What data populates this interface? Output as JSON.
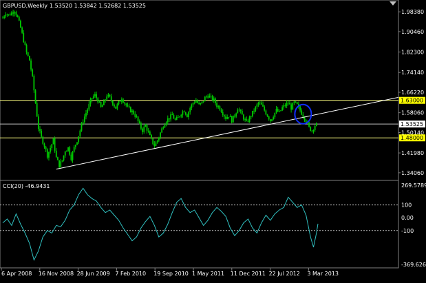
{
  "main_chart": {
    "title": "GBPUSD,Weekly",
    "ohlc": "1.53520 1.53842 1.52682 1.53525",
    "price_ticks": [
      "1.98380",
      "1.90460",
      "1.82300",
      "1.74140",
      "1.66220",
      "1.58060",
      "1.50140",
      "1.41980",
      "1.34060"
    ],
    "current_price": "1.53525",
    "levels": [
      {
        "label": "1.63000",
        "value": 1.63
      },
      {
        "label": "1.48000",
        "value": 1.48
      }
    ],
    "support_level": 1.53525,
    "trendline": {
      "start": {
        "date": "Oct 2008",
        "price": 1.355
      },
      "end": {
        "date": "Mar 2013+",
        "price": 1.64
      }
    },
    "highlight_circle": {
      "date": "Jan 2013",
      "price": 1.575
    }
  },
  "cci_panel": {
    "title": "CCI(20) -46.9431",
    "ticks": [
      "269.5789",
      "100",
      "0.00",
      "-100",
      "-369.6264"
    ],
    "levels": [
      100,
      -100
    ]
  },
  "date_ticks": [
    "6 Apr 2008",
    "16 Nov 2008",
    "28 Jun 2009",
    "7 Feb 2010",
    "19 Sep 2010",
    "1 May 2011",
    "11 Dec 2011",
    "22 Jul 2012",
    "3 Mar 2013"
  ],
  "colors": {
    "background": "#000000",
    "candle": "#00c800",
    "grid_level": "#ffff80",
    "price_line": "#c0c0c0",
    "trendline": "#ffffff",
    "cci_line": "#30c0c0",
    "circle": "#1030ff",
    "price_tag": "#ffffff",
    "level_tag": "#ffff00"
  },
  "chart_data": [
    {
      "type": "candlestick",
      "title": "GBPUSD,Weekly",
      "ylim": [
        1.31,
        2.02
      ],
      "x": [
        "6 Apr 2008",
        "16 Nov 2008",
        "28 Jun 2009",
        "7 Feb 2010",
        "19 Sep 2010",
        "1 May 2011",
        "11 Dec 2011",
        "22 Jul 2012",
        "3 Mar 2013"
      ],
      "close_path": [
        [
          0,
          1.96
        ],
        [
          2,
          1.98
        ],
        [
          4,
          1.97
        ],
        [
          6,
          1.98
        ],
        [
          8,
          1.99
        ],
        [
          10,
          1.96
        ],
        [
          12,
          1.92
        ],
        [
          14,
          1.87
        ],
        [
          16,
          1.82
        ],
        [
          18,
          1.79
        ],
        [
          20,
          1.72
        ],
        [
          22,
          1.62
        ],
        [
          24,
          1.52
        ],
        [
          26,
          1.48
        ],
        [
          28,
          1.45
        ],
        [
          30,
          1.41
        ],
        [
          32,
          1.44
        ],
        [
          34,
          1.47
        ],
        [
          36,
          1.4
        ],
        [
          38,
          1.37
        ],
        [
          40,
          1.39
        ],
        [
          42,
          1.43
        ],
        [
          44,
          1.44
        ],
        [
          46,
          1.4
        ],
        [
          48,
          1.44
        ],
        [
          50,
          1.47
        ],
        [
          52,
          1.51
        ],
        [
          54,
          1.55
        ],
        [
          56,
          1.58
        ],
        [
          58,
          1.61
        ],
        [
          60,
          1.64
        ],
        [
          62,
          1.65
        ],
        [
          64,
          1.63
        ],
        [
          66,
          1.6
        ],
        [
          68,
          1.62
        ],
        [
          70,
          1.65
        ],
        [
          72,
          1.64
        ],
        [
          74,
          1.62
        ],
        [
          76,
          1.6
        ],
        [
          78,
          1.62
        ],
        [
          80,
          1.64
        ],
        [
          82,
          1.62
        ],
        [
          84,
          1.6
        ],
        [
          86,
          1.59
        ],
        [
          88,
          1.58
        ],
        [
          90,
          1.56
        ],
        [
          92,
          1.53
        ],
        [
          94,
          1.51
        ],
        [
          96,
          1.53
        ],
        [
          98,
          1.5
        ],
        [
          100,
          1.47
        ],
        [
          102,
          1.45
        ],
        [
          104,
          1.47
        ],
        [
          106,
          1.5
        ],
        [
          108,
          1.53
        ],
        [
          110,
          1.55
        ],
        [
          112,
          1.56
        ],
        [
          114,
          1.57
        ],
        [
          116,
          1.55
        ],
        [
          118,
          1.56
        ],
        [
          120,
          1.58
        ],
        [
          122,
          1.59
        ],
        [
          124,
          1.57
        ],
        [
          126,
          1.6
        ],
        [
          128,
          1.62
        ],
        [
          130,
          1.63
        ],
        [
          132,
          1.61
        ],
        [
          134,
          1.62
        ],
        [
          136,
          1.64
        ],
        [
          138,
          1.65
        ],
        [
          140,
          1.64
        ],
        [
          142,
          1.63
        ],
        [
          144,
          1.61
        ],
        [
          146,
          1.6
        ],
        [
          148,
          1.58
        ],
        [
          150,
          1.56
        ],
        [
          152,
          1.57
        ],
        [
          154,
          1.55
        ],
        [
          156,
          1.57
        ],
        [
          158,
          1.6
        ],
        [
          160,
          1.58
        ],
        [
          162,
          1.56
        ],
        [
          164,
          1.54
        ],
        [
          166,
          1.56
        ],
        [
          168,
          1.58
        ],
        [
          170,
          1.6
        ],
        [
          172,
          1.62
        ],
        [
          174,
          1.61
        ],
        [
          176,
          1.59
        ],
        [
          178,
          1.57
        ],
        [
          180,
          1.55
        ],
        [
          182,
          1.57
        ],
        [
          184,
          1.59
        ],
        [
          186,
          1.58
        ],
        [
          188,
          1.6
        ],
        [
          190,
          1.61
        ],
        [
          192,
          1.62
        ],
        [
          194,
          1.6
        ],
        [
          196,
          1.62
        ],
        [
          198,
          1.61
        ],
        [
          200,
          1.59
        ],
        [
          202,
          1.57
        ],
        [
          204,
          1.55
        ],
        [
          206,
          1.52
        ],
        [
          208,
          1.51
        ],
        [
          210,
          1.53
        ],
        [
          212,
          1.53525
        ]
      ]
    },
    {
      "type": "line",
      "title": "CCI(20) -46.9431",
      "ylim": [
        -369.6264,
        269.5789
      ],
      "points": [
        [
          0,
          -40
        ],
        [
          3,
          -10
        ],
        [
          6,
          -60
        ],
        [
          9,
          30
        ],
        [
          12,
          -50
        ],
        [
          15,
          -120
        ],
        [
          18,
          -200
        ],
        [
          21,
          -330
        ],
        [
          24,
          -260
        ],
        [
          27,
          -150
        ],
        [
          30,
          -100
        ],
        [
          33,
          -120
        ],
        [
          36,
          -60
        ],
        [
          39,
          -70
        ],
        [
          42,
          -20
        ],
        [
          45,
          60
        ],
        [
          48,
          100
        ],
        [
          51,
          180
        ],
        [
          54,
          230
        ],
        [
          57,
          180
        ],
        [
          60,
          150
        ],
        [
          63,
          130
        ],
        [
          66,
          80
        ],
        [
          69,
          40
        ],
        [
          72,
          60
        ],
        [
          75,
          20
        ],
        [
          78,
          -20
        ],
        [
          81,
          -80
        ],
        [
          84,
          -130
        ],
        [
          87,
          -180
        ],
        [
          90,
          -150
        ],
        [
          93,
          -80
        ],
        [
          96,
          -30
        ],
        [
          99,
          10
        ],
        [
          102,
          -60
        ],
        [
          105,
          -150
        ],
        [
          108,
          -120
        ],
        [
          111,
          -50
        ],
        [
          114,
          40
        ],
        [
          117,
          120
        ],
        [
          120,
          150
        ],
        [
          123,
          80
        ],
        [
          126,
          40
        ],
        [
          129,
          60
        ],
        [
          132,
          0
        ],
        [
          135,
          -60
        ],
        [
          138,
          -20
        ],
        [
          141,
          40
        ],
        [
          144,
          80
        ],
        [
          147,
          50
        ],
        [
          150,
          10
        ],
        [
          153,
          -80
        ],
        [
          156,
          -140
        ],
        [
          159,
          -100
        ],
        [
          162,
          -40
        ],
        [
          165,
          -10
        ],
        [
          168,
          -80
        ],
        [
          171,
          -120
        ],
        [
          174,
          -40
        ],
        [
          177,
          20
        ],
        [
          180,
          -20
        ],
        [
          183,
          30
        ],
        [
          186,
          60
        ],
        [
          189,
          80
        ],
        [
          192,
          160
        ],
        [
          195,
          120
        ],
        [
          198,
          80
        ],
        [
          201,
          100
        ],
        [
          204,
          20
        ],
        [
          207,
          -150
        ],
        [
          209,
          -230
        ],
        [
          211,
          -120
        ],
        [
          212,
          -46.9431
        ]
      ]
    }
  ]
}
